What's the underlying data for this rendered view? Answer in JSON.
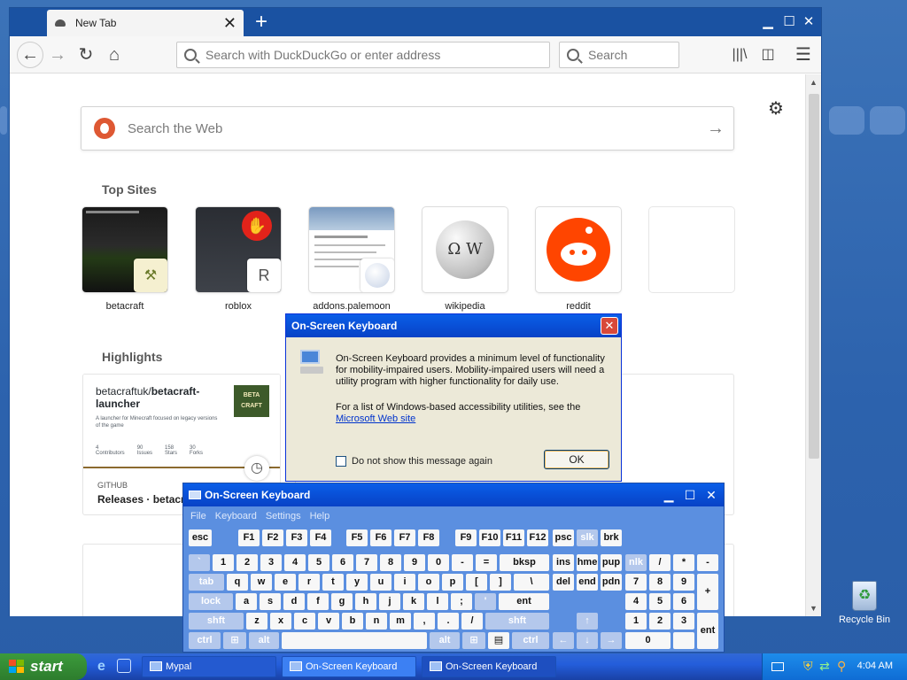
{
  "browser": {
    "tab_title": "New Tab",
    "url_placeholder": "Search with DuckDuckGo or enter address",
    "search_placeholder": "Search"
  },
  "newtab": {
    "web_search_placeholder": "Search the Web",
    "top_sites_title": "Top Sites",
    "top_sites": [
      {
        "name": "betacraft",
        "badge": ""
      },
      {
        "name": "roblox",
        "badge": "R"
      },
      {
        "name": "addons.palemoon",
        "badge": ""
      },
      {
        "name": "wikipedia",
        "badge": ""
      },
      {
        "name": "reddit",
        "badge": ""
      }
    ],
    "highlights_title": "Highlights",
    "highlight": {
      "repo_user": "betacraftuk/",
      "repo_name": "betacraft-launcher",
      "description": "A launcher for Minecraft focused on legacy versions of the game",
      "logo_text": "BETA CRAFT",
      "stats": [
        {
          "value": "4",
          "label": "Contributors"
        },
        {
          "value": "90",
          "label": "Issues"
        },
        {
          "value": "158",
          "label": "Stars"
        },
        {
          "value": "30",
          "label": "Forks"
        }
      ],
      "source": "GITHUB",
      "title": "Releases · betacra"
    }
  },
  "info_dialog": {
    "title": "On-Screen Keyboard",
    "text1": "On-Screen Keyboard provides a minimum level of functionality for mobility-impaired users. Mobility-impaired users will need a utility program with higher functionality for daily use.",
    "text2": "For a list of Windows-based accessibility utilities, see the",
    "link": "Microsoft Web site",
    "checkbox": "Do not show this message again",
    "ok": "OK"
  },
  "osk": {
    "title": "On-Screen Keyboard",
    "menu": [
      "File",
      "Keyboard",
      "Settings",
      "Help"
    ]
  },
  "taskbar": {
    "start": "start",
    "items": [
      "Mypal",
      "On-Screen Keyboard",
      "On-Screen Keyboard"
    ],
    "clock": "4:04 AM"
  },
  "desktop": {
    "recycle_bin": "Recycle Bin"
  }
}
